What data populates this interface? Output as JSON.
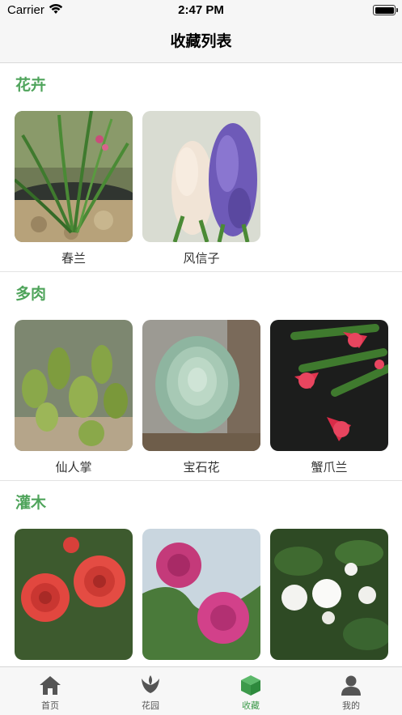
{
  "status_bar": {
    "carrier": "Carrier",
    "time": "2:47 PM",
    "battery_level": 1.0
  },
  "nav": {
    "title": "收藏列表"
  },
  "sections": [
    {
      "title": "花卉",
      "items": [
        {
          "name": "春兰"
        },
        {
          "name": "风信子"
        }
      ]
    },
    {
      "title": "多肉",
      "items": [
        {
          "name": "仙人掌"
        },
        {
          "name": "宝石花"
        },
        {
          "name": "蟹爪兰"
        }
      ]
    },
    {
      "title": "灌木",
      "items": [
        {
          "name": ""
        },
        {
          "name": ""
        },
        {
          "name": ""
        }
      ]
    }
  ],
  "tab_bar": {
    "items": [
      {
        "label": "首页",
        "icon": "home-icon"
      },
      {
        "label": "花园",
        "icon": "plant-icon"
      },
      {
        "label": "收藏",
        "icon": "cube-icon",
        "active": true
      },
      {
        "label": "我的",
        "icon": "person-icon"
      }
    ]
  },
  "colors": {
    "accent": "#4fa45b",
    "active_tab": "#3d9a4b",
    "bar_bg": "#f6f6f6"
  }
}
